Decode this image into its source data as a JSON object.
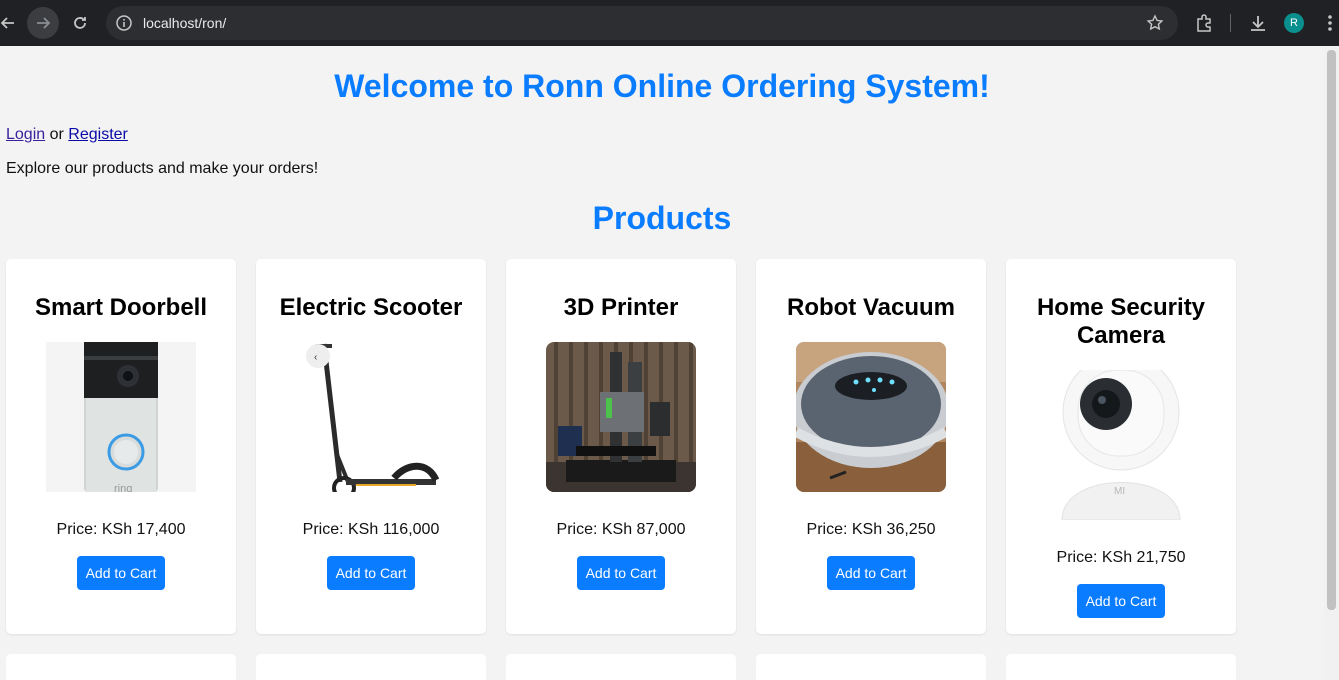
{
  "browser": {
    "url": "localhost/ron/",
    "profile_initial": "R"
  },
  "page": {
    "welcome": "Welcome to Ronn Online Ordering System!",
    "login_link": "Login",
    "or_text": " or ",
    "register_link": "Register",
    "intro": "Explore our products and make your orders!",
    "products_title": "Products"
  },
  "products": [
    {
      "name": "Smart Doorbell",
      "price": "Price: KSh 17,400",
      "button": "Add to Cart",
      "image_icon": "doorbell-image"
    },
    {
      "name": "Electric Scooter",
      "price": "Price: KSh 116,000",
      "button": "Add to Cart",
      "image_icon": "scooter-image"
    },
    {
      "name": "3D Printer",
      "price": "Price: KSh 87,000",
      "button": "Add to Cart",
      "image_icon": "printer-image"
    },
    {
      "name": "Robot Vacuum",
      "price": "Price: KSh 36,250",
      "button": "Add to Cart",
      "image_icon": "vacuum-image"
    },
    {
      "name": "Home Security Camera",
      "price": "Price: KSh 21,750",
      "button": "Add to Cart",
      "image_icon": "camera-image"
    }
  ],
  "colors": {
    "accent": "#0a7cff",
    "background": "#f3f3f3"
  }
}
